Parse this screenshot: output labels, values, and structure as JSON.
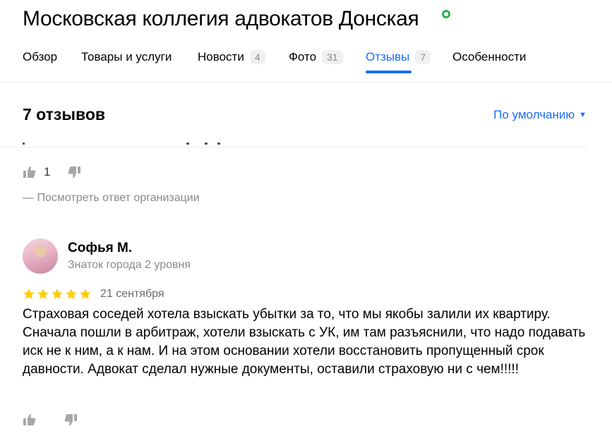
{
  "org": {
    "title": "Московская коллегия адвокатов Донская",
    "verified_icon": "verified-badge-icon"
  },
  "tabs": [
    {
      "label": "Обзор",
      "count": ""
    },
    {
      "label": "Товары и услуги",
      "count": ""
    },
    {
      "label": "Новости",
      "count": "4"
    },
    {
      "label": "Фото",
      "count": "31"
    },
    {
      "label": "Отзывы",
      "count": "7"
    },
    {
      "label": "Особенности",
      "count": ""
    }
  ],
  "active_tab": "Отзывы",
  "reviews_header": {
    "count_label": "7 отзывов",
    "sort_label": "По умолчанию"
  },
  "previous_review": {
    "likes": "1",
    "org_reply_label": "— Посмотреть ответ организации"
  },
  "review": {
    "author_name": "Софья М.",
    "author_level": "Знаток города 2 уровня",
    "rating": 5,
    "date": "21 сентября",
    "text": "Страховая соседей хотела взыскать убытки за то, что мы якобы залили их квартиру. Сначала пошли в арбитраж, хотели взыскать с УК, им там разъяснили, что надо подавать иск не к ним, а к нам. И на этом основании хотели восстановить пропущенный срок давности. Адвокат сделал нужные документы, оставили страховую ни с чем!!!!!"
  },
  "colors": {
    "accent": "#196dff",
    "star": "#fc0",
    "muted": "#8a8a8a",
    "verified": "#2bb24c"
  }
}
